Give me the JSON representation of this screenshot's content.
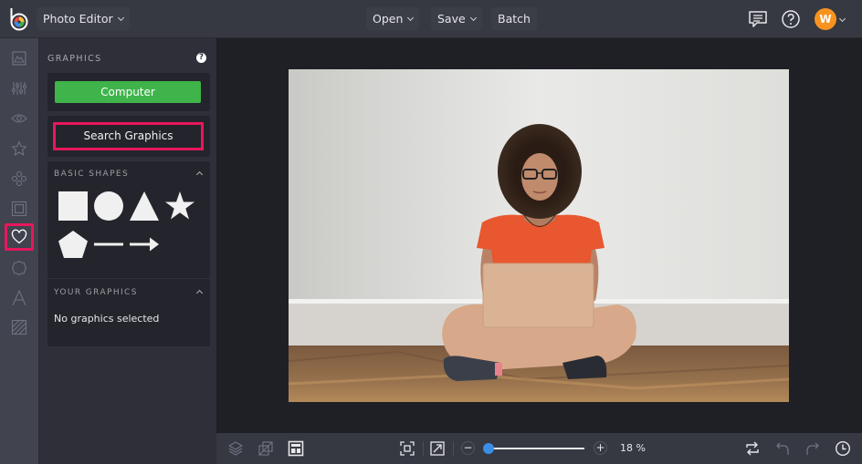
{
  "topbar": {
    "app_menu_label": "Photo Editor",
    "open_label": "Open",
    "save_label": "Save",
    "batch_label": "Batch",
    "avatar_initial": "W",
    "icons": [
      "logo",
      "comments-icon",
      "help-icon"
    ]
  },
  "rail": {
    "items": [
      {
        "name": "image-tools",
        "icon": "image-icon",
        "active": false
      },
      {
        "name": "adjustments",
        "icon": "sliders-icon",
        "active": false
      },
      {
        "name": "effects",
        "icon": "eye-icon",
        "active": false
      },
      {
        "name": "touch-up",
        "icon": "star-icon",
        "active": false
      },
      {
        "name": "overlays",
        "icon": "circles-icon",
        "active": false
      },
      {
        "name": "frames",
        "icon": "frame-icon",
        "active": false
      },
      {
        "name": "graphics",
        "icon": "heart-icon",
        "active": true
      },
      {
        "name": "badges",
        "icon": "badge-icon",
        "active": false
      },
      {
        "name": "text",
        "icon": "text-icon",
        "active": false
      },
      {
        "name": "textures",
        "icon": "texture-icon",
        "active": false
      }
    ]
  },
  "panel": {
    "title": "GRAPHICS",
    "help_glyph": "?",
    "computer_label": "Computer",
    "search_label": "Search Graphics",
    "basic_shapes": {
      "heading": "BASIC SHAPES",
      "shapes": [
        "square",
        "circle",
        "triangle",
        "star",
        "pentagon",
        "line",
        "arrow"
      ]
    },
    "your_graphics": {
      "heading": "YOUR GRAPHICS",
      "empty_text": "No graphics selected"
    }
  },
  "canvas": {
    "image_description": "Woman with curly hair in orange top sitting cross-legged on wooden floor using a laptop against a white wall"
  },
  "bottombar": {
    "zoom_out": "−",
    "zoom_in": "+",
    "zoom_value": "18 %",
    "zoom_fraction": 0.02
  },
  "colors": {
    "accent_highlight": "#e8175d",
    "computer_button": "#3fb44b",
    "avatar": "#f7931e",
    "slider_thumb": "#3a8ee6"
  }
}
